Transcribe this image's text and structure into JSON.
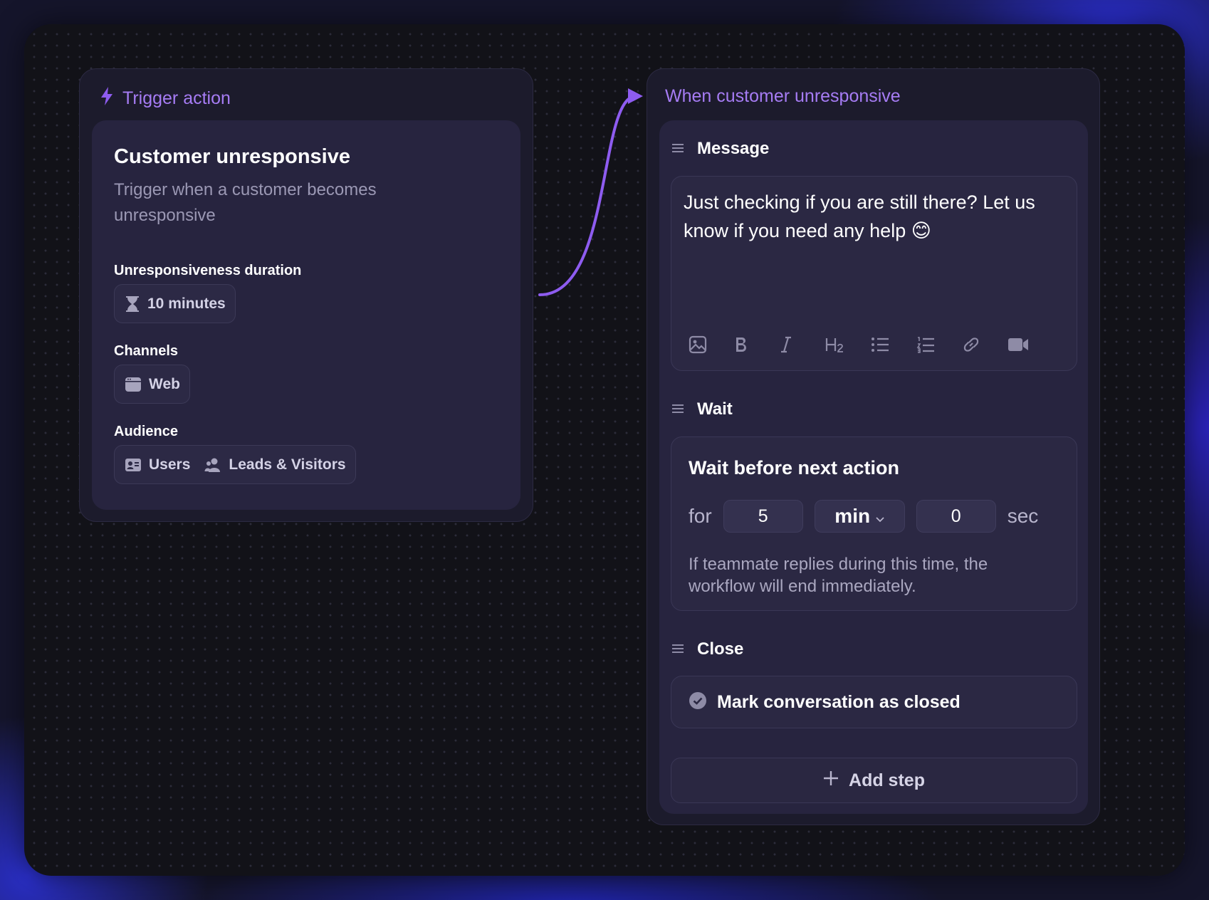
{
  "trigger": {
    "section_title": "Trigger action",
    "heading": "Customer unresponsive",
    "description": "Trigger when a customer becomes unresponsive",
    "duration_label": "Unresponsiveness duration",
    "duration_value": "10 minutes",
    "channels_label": "Channels",
    "channel_value": "Web",
    "audience_label": "Audience",
    "audience_values": [
      "Users",
      "Leads & Visitors"
    ]
  },
  "workflow": {
    "section_title": "When customer unresponsive",
    "message": {
      "step_label": "Message",
      "text": "Just checking if you are still there? Let us know if you need any help 😊",
      "toolbar": [
        "image-icon",
        "bold-icon",
        "italic-icon",
        "heading2-icon",
        "bullet-list-icon",
        "numbered-list-icon",
        "link-icon",
        "video-icon"
      ]
    },
    "wait": {
      "step_label": "Wait",
      "title": "Wait before next action",
      "for_label": "for",
      "amount": "5",
      "unit": "min",
      "seconds": "0",
      "sec_label": "sec",
      "note": "If teammate replies during this time, the workflow will end immediately."
    },
    "close": {
      "step_label": "Close",
      "action_label": "Mark conversation as closed"
    },
    "add_step_label": "Add step"
  },
  "colors": {
    "accent": "#a67cf4",
    "panel": "#1c1b2c",
    "card": "#27243f",
    "canvas": "#121218"
  }
}
